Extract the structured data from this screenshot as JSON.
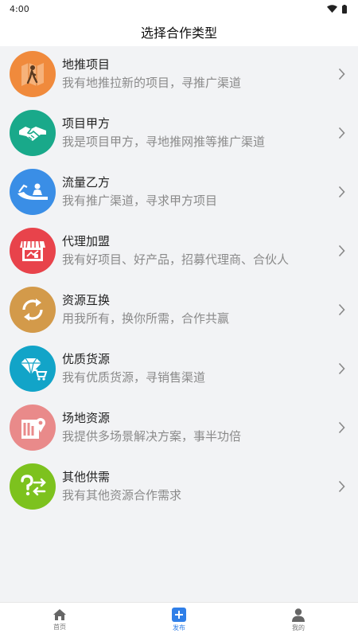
{
  "status_bar": {
    "time": "4:00"
  },
  "header": {
    "title": "选择合作类型"
  },
  "items": [
    {
      "title": "地推项目",
      "desc": "我有地推拉新的项目，寻推广渠道",
      "color": "#f08a3c",
      "icon": "ground-promotion-icon"
    },
    {
      "title": "项目甲方",
      "desc": "我是项目甲方，寻地推网推等推广渠道",
      "color": "#19a98a",
      "icon": "handshake-icon"
    },
    {
      "title": "流量乙方",
      "desc": "我有推广渠道，寻求甲方项目",
      "color": "#3a8ee6",
      "icon": "traffic-icon"
    },
    {
      "title": "代理加盟",
      "desc": "我有好项目、好产品，招募代理商、合伙人",
      "color": "#e8434b",
      "icon": "store-icon"
    },
    {
      "title": "资源互换",
      "desc": "用我所有，换你所需，合作共赢",
      "color": "#d39a4a",
      "icon": "exchange-icon"
    },
    {
      "title": "优质货源",
      "desc": "我有优质货源，寻销售渠道",
      "color": "#12a4c8",
      "icon": "diamond-cart-icon"
    },
    {
      "title": "场地资源",
      "desc": "我提供多场景解决方案，事半功倍",
      "color": "#e98a8a",
      "icon": "venue-map-icon"
    },
    {
      "title": "其他供需",
      "desc": "我有其他资源合作需求",
      "color": "#7dc21e",
      "icon": "question-exchange-icon"
    }
  ],
  "tabbar": {
    "home": "首页",
    "publish": "发布",
    "mine": "我的",
    "active_color": "#2f7fe8"
  }
}
